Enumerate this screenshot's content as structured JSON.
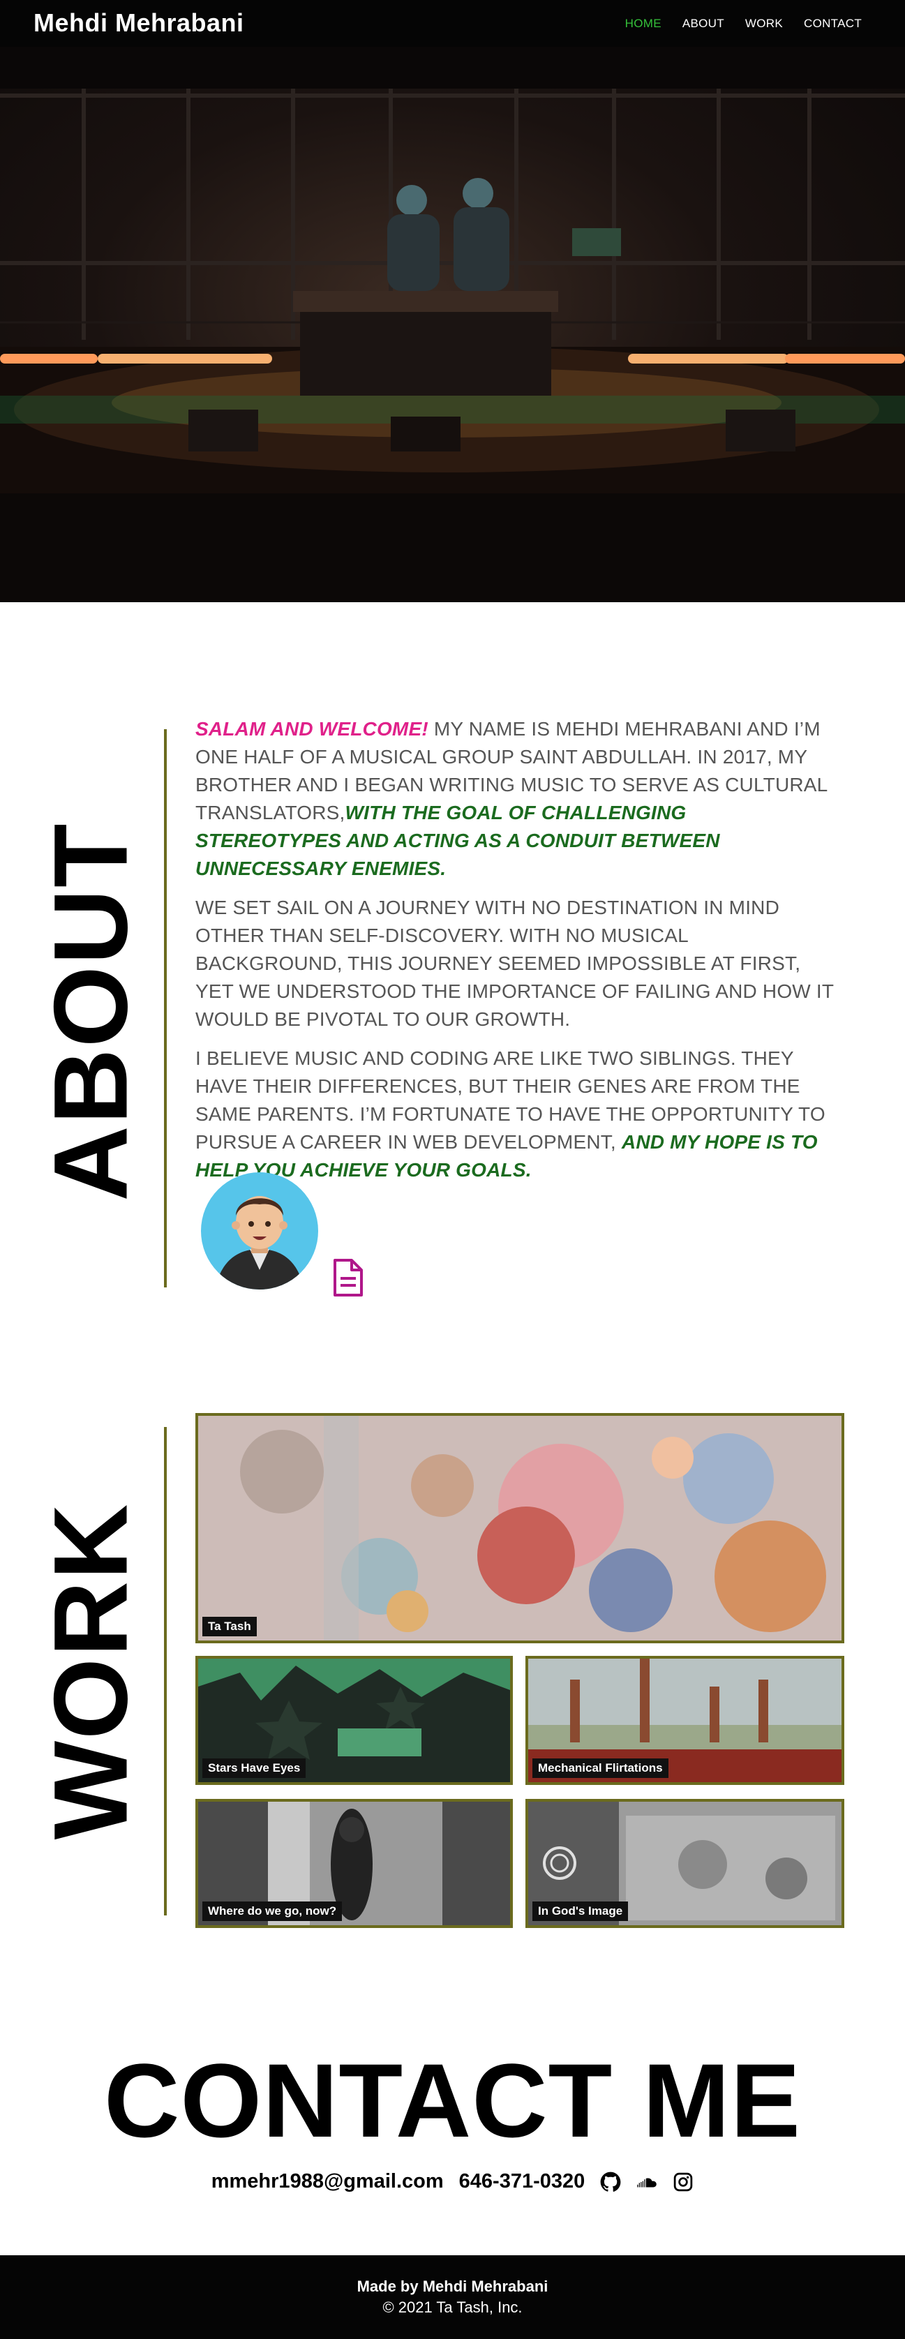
{
  "nav": {
    "brand": "Mehdi Mehrabani",
    "links": [
      "HOME",
      "ABOUT",
      "WORK",
      "CONTACT"
    ],
    "active_link": "HOME",
    "active_color": "#35c23a"
  },
  "about": {
    "heading": "ABOUT",
    "p1_highlight": "SALAM AND WELCOME!",
    "p1_text": " MY NAME IS MEHDI MEHRABANI AND I’M ONE HALF OF A MUSICAL GROUP SAINT ABDULLAH. IN 2017, MY BROTHER AND I BEGAN WRITING MUSIC TO SERVE AS CULTURAL TRANSLATORS,",
    "p1_green": "WITH THE GOAL OF CHALLENGING STEREOTYPES AND ACTING AS A CONDUIT BETWEEN UNNECESSARY ENEMIES.",
    "p2_text": "WE SET SAIL ON A JOURNEY WITH NO DESTINATION IN MIND OTHER THAN SELF-DISCOVERY. WITH NO MUSICAL BACKGROUND, THIS JOURNEY SEEMED IMPOSSIBLE AT FIRST, YET WE UNDERSTOOD THE IMPORTANCE OF FAILING AND HOW IT WOULD BE PIVOTAL TO OUR GROWTH.",
    "p3_text": "I BELIEVE MUSIC AND CODING ARE LIKE TWO SIBLINGS. THEY HAVE THEIR DIFFERENCES, BUT THEIR GENES ARE FROM THE SAME PARENTS. I’M FORTUNATE TO HAVE THE OPPORTUNITY TO PURSUE A CAREER IN WEB DEVELOPMENT, ",
    "p3_green": "AND MY HOPE IS TO HELP YOU ACHIEVE YOUR GOALS.",
    "highlight_pink": "#e0218a",
    "highlight_green": "#1b6b1f",
    "resume_icon": "document-icon"
  },
  "work": {
    "heading": "WORK",
    "projects": [
      "Ta Tash",
      "Stars Have Eyes",
      "Mechanical Flirtations",
      "Where do we go, now?",
      "In God's Image"
    ],
    "border_color": "#6b6b1e"
  },
  "contact": {
    "heading": "CONTACT ME",
    "email": "mmehr1988@gmail.com",
    "phone": "646-371-0320",
    "icons": [
      "github-icon",
      "soundcloud-icon",
      "instagram-icon"
    ]
  },
  "footer": {
    "made_by": "Made by Mehdi Mehrabani",
    "copyright": "© 2021 Ta Tash, Inc."
  }
}
